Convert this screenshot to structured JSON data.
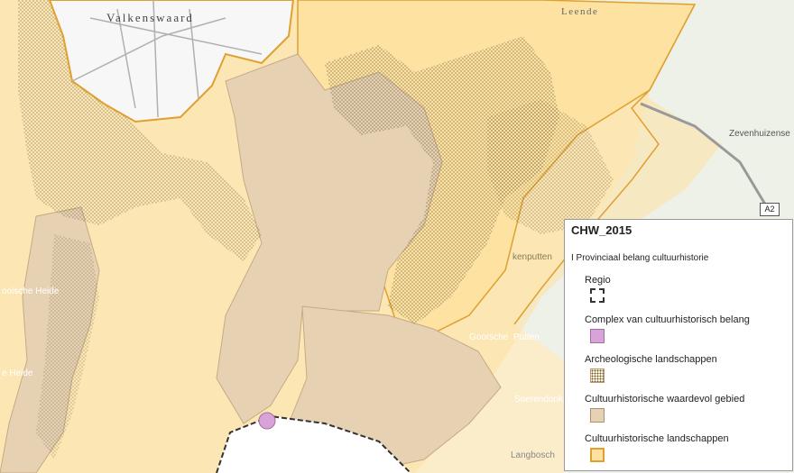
{
  "map": {
    "places": {
      "valkenswaard": "Valkenswaard",
      "leende": "Leende",
      "zevenhuizen": "Zevenhuizense",
      "gooische_heide": "ooische Heide",
      "he_heide": "e Heide",
      "sterkenputten": "kenputten",
      "goorsche_putten_1": "Goorsche",
      "goorsche_putten_2": "Putten",
      "soerendonkse": "Soerendonkse",
      "langbosch": "Langbosch"
    },
    "road_shield": "A2"
  },
  "legend": {
    "title": "CHW_2015",
    "group_label": "I Provinciaal belang cultuurhistorie",
    "items": [
      {
        "label": "Regio",
        "swatch": "dashed-outline"
      },
      {
        "label": "Complex van cultuurhistorisch belang",
        "swatch": "#d8a3d8"
      },
      {
        "label": "Archeologische landschappen",
        "swatch": "dotted"
      },
      {
        "label": "Cultuurhistorische waardevol gebied",
        "swatch": "#e6d2b3"
      },
      {
        "label": "Cultuurhistorische landschappen",
        "swatch": "#fde2a2"
      }
    ]
  }
}
